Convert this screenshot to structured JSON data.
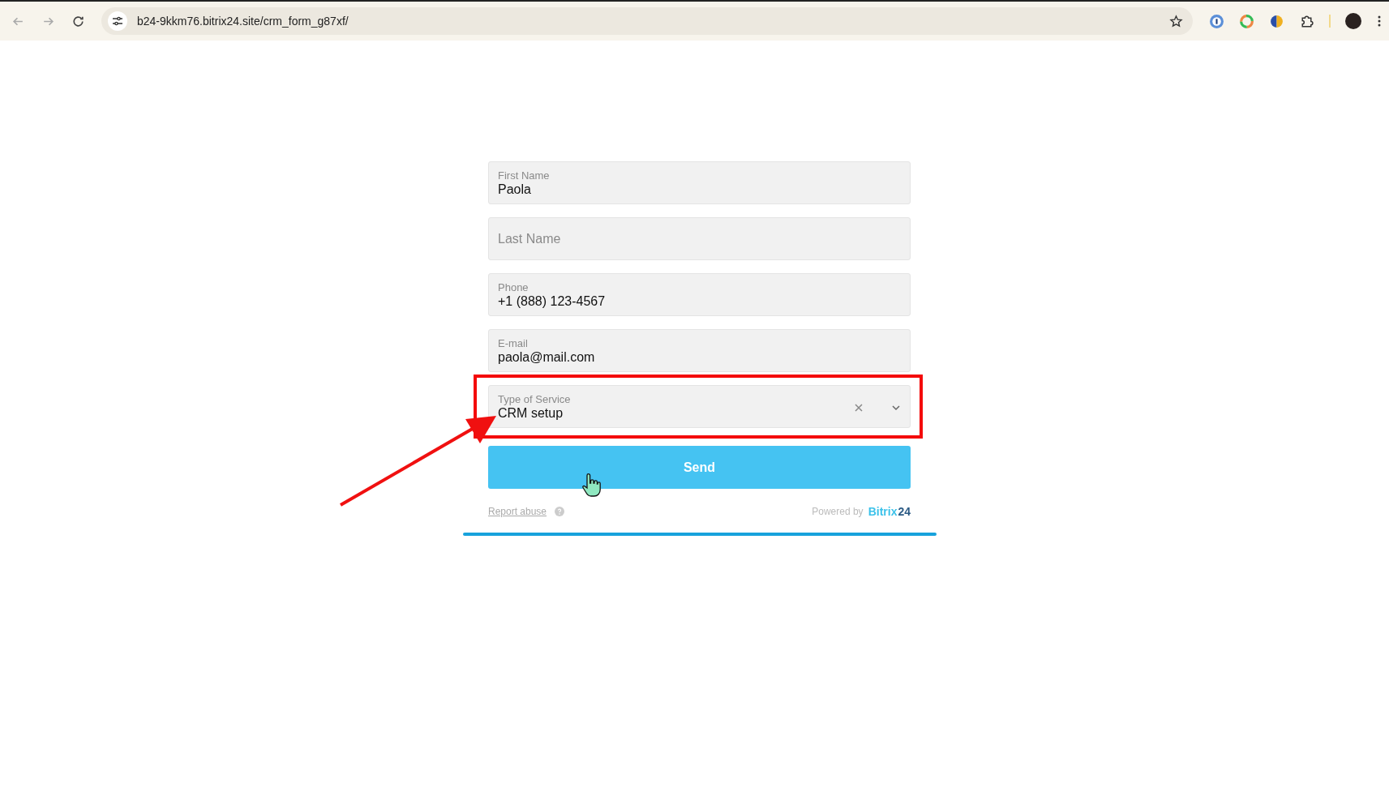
{
  "browser": {
    "url": "b24-9kkm76.bitrix24.site/crm_form_g87xf/"
  },
  "form": {
    "fields": [
      {
        "kind": "text",
        "label": "First Name",
        "value": "Paola",
        "highlighted": false
      },
      {
        "kind": "text",
        "placeholder": "Last Name",
        "highlighted": false
      },
      {
        "kind": "text",
        "label": "Phone",
        "value": "+1 (888) 123-4567",
        "highlighted": false
      },
      {
        "kind": "text",
        "label": "E-mail",
        "value": "paola@mail.com",
        "highlighted": false
      },
      {
        "kind": "select",
        "label": "Type of Service",
        "value": "CRM setup",
        "highlighted": true
      }
    ],
    "submit": "Send",
    "report_link": "Report abuse",
    "powered_by": "Powered by",
    "logo": {
      "name": "Bitrix",
      "number": "24"
    }
  }
}
